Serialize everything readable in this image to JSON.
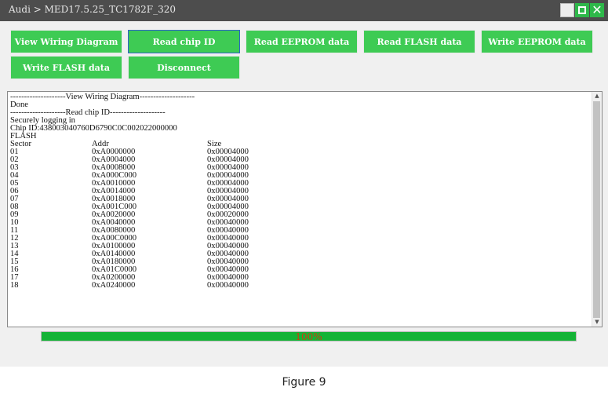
{
  "window": {
    "title": "Audi > MED17.5.25_TC1782F_320",
    "minimize_icon": "minimize-icon",
    "maximize_icon": "maximize-icon",
    "close_icon": "close-icon",
    "accent": "#2eb84a"
  },
  "toolbar": {
    "view_wiring": "View Wiring Diagram",
    "read_chip": "Read chip ID",
    "read_eeprom": "Read EEPROM data",
    "read_flash": "Read FLASH data",
    "write_eeprom": "Write EEPROM data",
    "write_flash": "Write FLASH data",
    "disconnect": "Disconnect",
    "button_color": "#3ecb54"
  },
  "log": {
    "lines": [
      "--------------------View Wiring Diagram--------------------",
      "Done",
      "--------------------Read chip ID--------------------",
      "Securely logging in",
      "Chip ID:438003040760D6790C0C002022000000",
      "FLASH"
    ],
    "headers": [
      "Sector",
      "Addr",
      "Size"
    ],
    "rows": [
      [
        "01",
        "0xA0000000",
        "0x00004000"
      ],
      [
        "02",
        "0xA0004000",
        "0x00004000"
      ],
      [
        "03",
        "0xA0008000",
        "0x00004000"
      ],
      [
        "04",
        "0xA000C000",
        "0x00004000"
      ],
      [
        "05",
        "0xA0010000",
        "0x00004000"
      ],
      [
        "06",
        "0xA0014000",
        "0x00004000"
      ],
      [
        "07",
        "0xA0018000",
        "0x00004000"
      ],
      [
        "08",
        "0xA001C000",
        "0x00004000"
      ],
      [
        "09",
        "0xA0020000",
        "0x00020000"
      ],
      [
        "10",
        "0xA0040000",
        "0x00040000"
      ],
      [
        "11",
        "0xA0080000",
        "0x00040000"
      ],
      [
        "12",
        "0xA00C0000",
        "0x00040000"
      ],
      [
        "13",
        "0xA0100000",
        "0x00040000"
      ],
      [
        "14",
        "0xA0140000",
        "0x00040000"
      ],
      [
        "15",
        "0xA0180000",
        "0x00040000"
      ],
      [
        "16",
        "0xA01C0000",
        "0x00040000"
      ],
      [
        "17",
        "0xA0200000",
        "0x00040000"
      ],
      [
        "18",
        "0xA0240000",
        "0x00040000"
      ]
    ]
  },
  "progress": {
    "value": 1.0,
    "label": "100%",
    "fill_color": "#14b336",
    "label_color": "#d13a0e"
  },
  "caption": "Figure 9"
}
